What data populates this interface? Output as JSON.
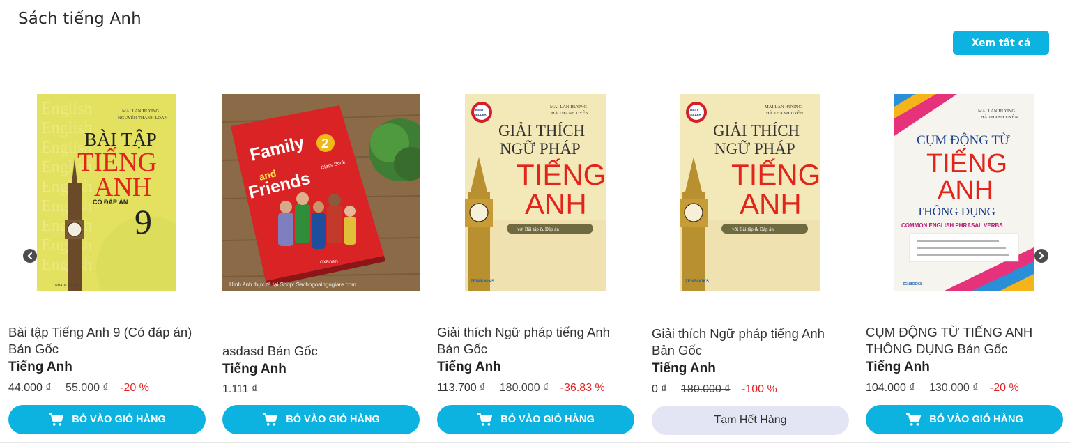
{
  "section": {
    "title": "Sách tiếng Anh",
    "view_all_label": "Xem tất cả"
  },
  "icons": {
    "prev": "chevron-left-icon",
    "next": "chevron-right-icon",
    "cart": "cart-icon"
  },
  "colors": {
    "accent": "#0db3e0",
    "discount": "#e02424",
    "out_of_stock_bg": "#e3e5f5"
  },
  "products": [
    {
      "name": "Bài tập Tiếng Anh 9 (Có đáp án) Bản Gốc",
      "category": "Tiếng Anh",
      "price": "44.000 ₫",
      "old_price": "55.000 ₫",
      "discount": "-20 %",
      "button": "BỎ VÀO GIỎ HÀNG",
      "cover": {
        "authors": [
          "MAI LAN HƯƠNG",
          "NGUYỄN THANH LOAN"
        ],
        "lines": [
          "BÀI TẬP",
          "TIẾNG",
          "ANH"
        ],
        "sub": "CÓ ĐÁP ÁN",
        "num": "9"
      }
    },
    {
      "name": "asdasd Bản Gốc",
      "category": "Tiếng Anh",
      "price": "1.111 ₫",
      "button": "BỎ VÀO GIỎ HÀNG",
      "cover": {
        "title": "Family and Friends",
        "num": "2",
        "sub": "Class Book",
        "caption": "Hình ảnh thực tế tại Shop: Sachngoaingugiare.com"
      }
    },
    {
      "name": "Giải thích Ngữ pháp tiếng Anh Bản Gốc",
      "category": "Tiếng Anh",
      "price": "113.700 ₫",
      "old_price": "180.000 ₫",
      "discount": "-36.83 %",
      "button": "BỎ VÀO GIỎ HÀNG",
      "cover": {
        "authors": [
          "MAI LAN HƯƠNG",
          "HÀ THANH UYÊN"
        ],
        "lines": [
          "GIẢI THÍCH",
          "NGỮ PHÁP",
          "TIẾNG",
          "ANH"
        ],
        "sub": "với Bài tập & Đáp án",
        "badge": "BEST SELLER"
      }
    },
    {
      "name": "Giải thích Ngữ pháp tiếng Anh Bản Gốc",
      "category": "Tiếng Anh",
      "price": "0 ₫",
      "old_price": "180.000 ₫",
      "discount": "-100 %",
      "button": "Tạm Hết Hàng",
      "cover": {
        "authors": [
          "MAI LAN HƯƠNG",
          "HÀ THANH UYÊN"
        ],
        "lines": [
          "GIẢI THÍCH",
          "NGỮ PHÁP",
          "TIẾNG",
          "ANH"
        ],
        "sub": "với Bài tập & Đáp án",
        "badge": "BEST SELLER"
      }
    },
    {
      "name": "CỤM ĐỘNG TỪ TIẾNG ANH THÔNG DỤNG Bản Gốc",
      "category": "Tiếng Anh",
      "price": "104.000 ₫",
      "old_price": "130.000 ₫",
      "discount": "-20 %",
      "button": "BỎ VÀO GIỎ HÀNG",
      "cover": {
        "authors": [
          "MAI LAN HƯƠNG",
          "HÀ THANH UYÊN"
        ],
        "lines": [
          "CỤM ĐỘNG TỪ",
          "TIẾNG",
          "ANH",
          "THÔNG DỤNG"
        ],
        "sub": "COMMON ENGLISH PHRASAL VERBS"
      }
    }
  ]
}
